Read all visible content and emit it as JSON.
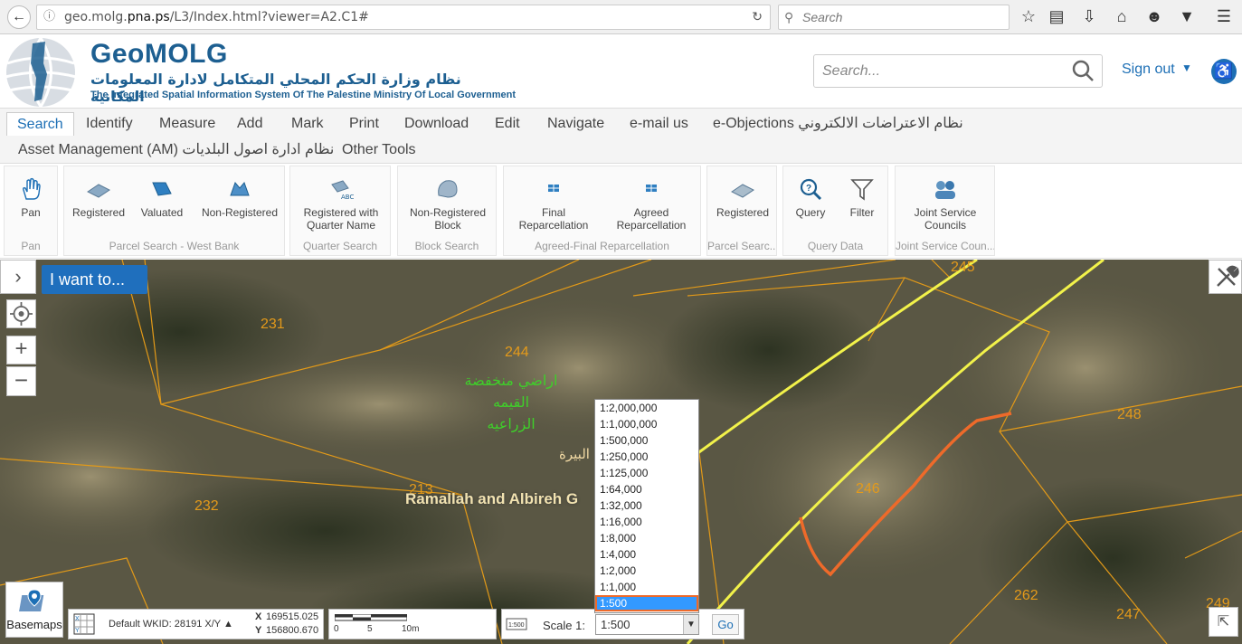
{
  "browser": {
    "url_prefix": "geo.molg.",
    "url_host": "pna.ps",
    "url_path": "/L3/Index.html?viewer=A2.C1#",
    "search_placeholder": "Search"
  },
  "header": {
    "brand": "GeoMOLG",
    "arabic_title": "نظام وزارة الحكم المحلي المتكامل لادارة المعلومات المكانية",
    "english_subtitle": "The Integrated Spatial Information System Of The Palestine Ministry Of Local Government",
    "search_placeholder": "Search...",
    "sign_out": "Sign out"
  },
  "menu": {
    "row1": [
      "Search",
      "Identify",
      "Measure",
      "Add",
      "Mark",
      "Print",
      "Download",
      "Edit",
      "Navigate",
      "e-mail us",
      "e-Objections نظام الاعتراضات الالكتروني"
    ],
    "row2": [
      "Asset Management (AM) نظام ادارة اصول البلديات",
      "Other Tools"
    ]
  },
  "ribbon": {
    "groups": [
      {
        "label": "Pan",
        "tools": [
          "Pan"
        ]
      },
      {
        "label": "Parcel Search - West Bank",
        "tools": [
          "Registered",
          "Valuated",
          "Non-Registered"
        ]
      },
      {
        "label": "Quarter Search",
        "tools": [
          "Registered with Quarter Name"
        ]
      },
      {
        "label": "Block Search",
        "tools": [
          "Non-Registered Block"
        ]
      },
      {
        "label": "Agreed-Final Reparcellation",
        "tools": [
          "Final Reparcellation",
          "Agreed Reparcellation"
        ]
      },
      {
        "label": "Parcel Searc...",
        "tools": [
          "Registered"
        ]
      },
      {
        "label": "Query Data",
        "tools": [
          "Query",
          "Filter"
        ]
      },
      {
        "label": "Joint Service Coun...",
        "tools": [
          "Joint Service Councils"
        ]
      }
    ]
  },
  "map": {
    "i_want_to": "I want to...",
    "parcels": [
      "245",
      "231",
      "244",
      "248",
      "213",
      "246",
      "232",
      "262",
      "247",
      "249"
    ],
    "green_label": [
      "اراضي منخفضة",
      "القيمه",
      "الزراعيه"
    ],
    "place_name": "Ramallah and Albireh G",
    "place_arabic": "البيرة",
    "basemaps": "Basemaps",
    "wkid": "Default WKID: 28191 X/Y ▲",
    "x_label": "X",
    "x_value": "169515.025",
    "y_label": "Y",
    "y_value": "156800.670",
    "scalebar_ticks": [
      "0",
      "5",
      "10m"
    ],
    "scale_label": "Scale 1:",
    "scale_value": "1:500",
    "go": "Go",
    "scale_options": [
      "1:2,000,000",
      "1:1,000,000",
      "1:500,000",
      "1:250,000",
      "1:125,000",
      "1:64,000",
      "1:32,000",
      "1:16,000",
      "1:8,000",
      "1:4,000",
      "1:2,000",
      "1:1,000",
      "1:500"
    ],
    "selected_scale": "1:500"
  },
  "colors": {
    "brand_blue": "#1d5f91",
    "accent_blue": "#1f6fbd",
    "parcel_orange": "#e49a1a",
    "road_yellow": "#f2f24a",
    "trace_orange": "#ee6a2a"
  }
}
